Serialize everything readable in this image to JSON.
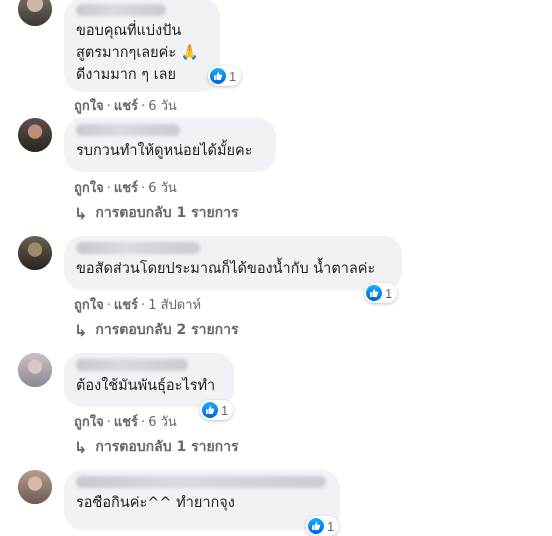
{
  "comments": [
    {
      "text": "ขอบคุณที่แบ่งปัน\nสูตรมากๆเลยค่ะ 🙏\nดีงามมาก ๆ เลย",
      "reactions": "1",
      "like_label": "ถูกใจ",
      "reply_label": "แชร์",
      "time": "6 วัน"
    },
    {
      "text": "รบกวนทำให้ดูหน่อยได้มั้ยคะ",
      "like_label": "ถูกใจ",
      "reply_label": "แชร์",
      "time": "6 วัน",
      "replies_label": "การตอบกลับ 1 รายการ"
    },
    {
      "text": "ขอสัดส่วนโดยประมาณก็ได้ของน้ำกับ น้ำตาลค่ะ",
      "reactions": "1",
      "like_label": "ถูกใจ",
      "reply_label": "แชร์",
      "time": "1 สัปดาห์",
      "replies_label": "การตอบกลับ 2 รายการ"
    },
    {
      "text": "ต้องใช้มันพันธุ์อะไรทำ",
      "reactions": "1",
      "like_label": "ถูกใจ",
      "reply_label": "แชร์",
      "time": "6 วัน",
      "replies_label": "การตอบกลับ 1 รายการ"
    },
    {
      "text": "รอซือกินค่ะ^^  ทำยากจุง",
      "reactions": "1"
    }
  ],
  "icons": {
    "like": "like-icon",
    "reply_arrow": "reply-arrow-icon"
  },
  "colors": {
    "bubble": "#f0f2f5",
    "meta_text": "#65676b",
    "like_blue": "#1877f2"
  }
}
